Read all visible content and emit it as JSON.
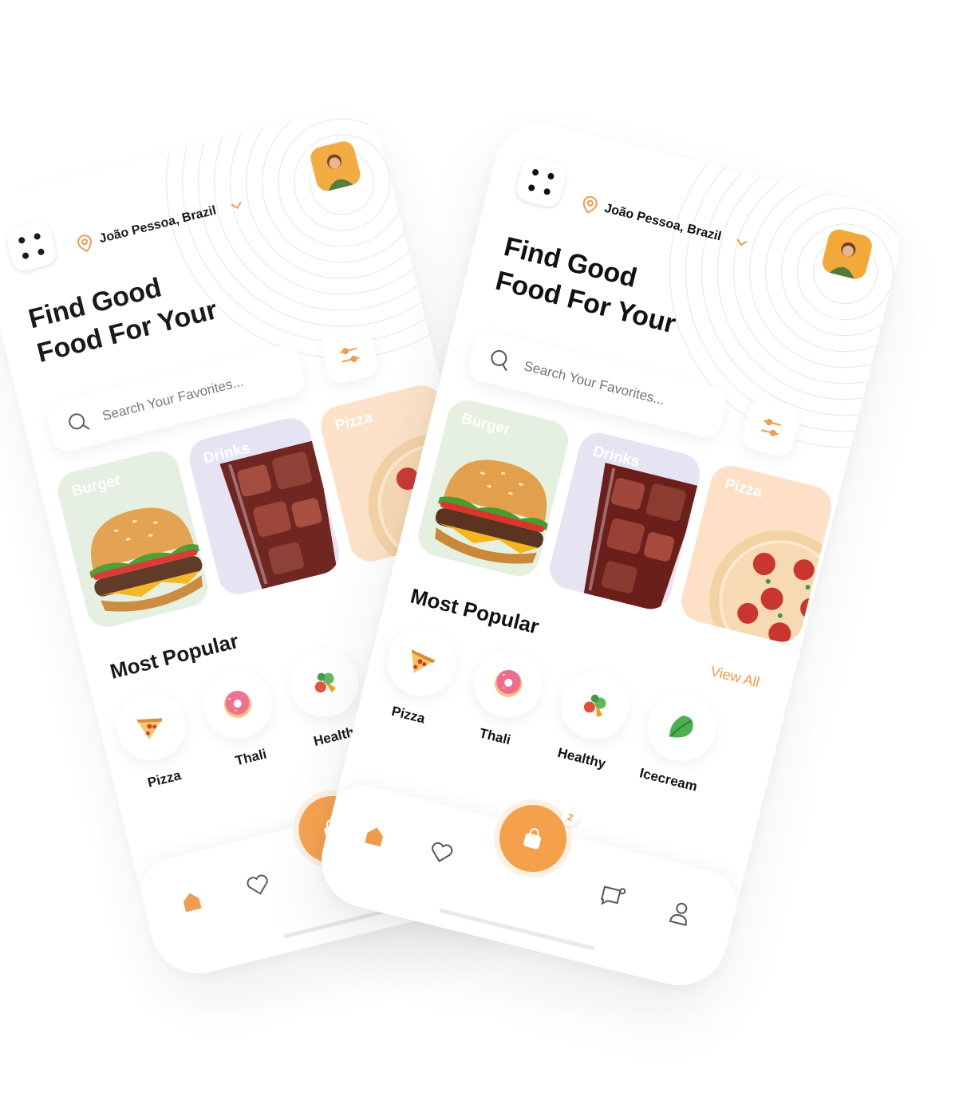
{
  "location": "João Pessoa, Brazil",
  "heading": [
    "Find Good",
    "Food For Your"
  ],
  "search": {
    "placeholder": "Search Your Favorites..."
  },
  "categories": [
    {
      "label": "Burger",
      "color": "#e6f0e1"
    },
    {
      "label": "Drinks",
      "color": "#e6e3f3"
    },
    {
      "label": "Pizza",
      "color": "#fde0c6"
    }
  ],
  "popular": {
    "title": "Most Popular",
    "view_all": "View All",
    "items": [
      {
        "label": "Pizza",
        "icon": "pizza-slice-icon"
      },
      {
        "label": "Thali",
        "icon": "donut-icon"
      },
      {
        "label": "Healthy",
        "icon": "vegetables-icon"
      },
      {
        "label": "Icecream",
        "icon": "lettuce-icon"
      }
    ]
  },
  "nav": {
    "cart_badge": "2"
  },
  "colors": {
    "accent": "#f2994a",
    "text": "#111111"
  }
}
